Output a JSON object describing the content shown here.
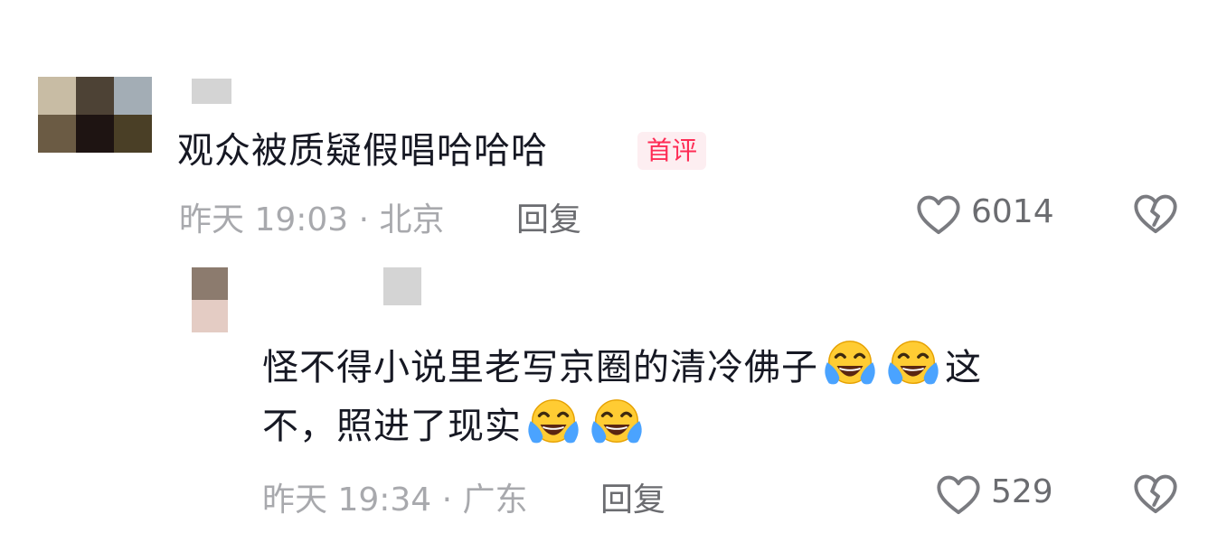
{
  "comment": {
    "text": "观众被质疑假唱哈哈哈",
    "badge": "首评",
    "timestamp": "昨天 19:03 · 北京",
    "reply_label": "回复",
    "like_count": "6014",
    "avatar_colors": [
      "#c8bca4",
      "#4d4235",
      "#a3adb5",
      "#6b5b44",
      "#1e1412",
      "#4a3f26"
    ],
    "replies": [
      {
        "text_line1": "怪不得小说里老写京圈的清冷佛子",
        "text_line1_end": "这",
        "text_line2": "不，照进了现实",
        "emoji": "face-with-tears-of-joy",
        "timestamp": "昨天 19:34 · 广东",
        "reply_label": "回复",
        "like_count": "529",
        "avatar_colors": [
          "#8c7b6e",
          "#e4ccc4"
        ]
      }
    ]
  }
}
